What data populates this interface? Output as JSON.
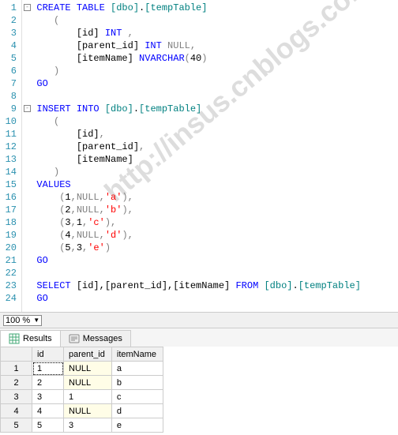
{
  "watermark": "http://insus.cnblogs.com",
  "gutter": [
    "1",
    "2",
    "3",
    "4",
    "5",
    "6",
    "7",
    "8",
    "9",
    "10",
    "11",
    "12",
    "13",
    "14",
    "15",
    "16",
    "17",
    "18",
    "19",
    "20",
    "21",
    "22",
    "23",
    "24"
  ],
  "code": {
    "l1": {
      "pre": "  ",
      "kw1": "CREATE TABLE ",
      "obj": "[dbo]",
      "dot": ".",
      "obj2": "[tempTable]"
    },
    "l2": {
      "pre": "     ",
      "p": "("
    },
    "l3": {
      "pre": "         ",
      "col": "[id] ",
      "type": "INT ",
      "rest": ","
    },
    "l4": {
      "pre": "         ",
      "col": "[parent_id] ",
      "type": "INT ",
      "null": "NULL",
      "rest": ","
    },
    "l5": {
      "pre": "         ",
      "col": "[itemName] ",
      "type": "NVARCHAR",
      "p1": "(",
      "n": "40",
      "p2": ")"
    },
    "l6": {
      "pre": "     ",
      "p": ")"
    },
    "l7": {
      "pre": "  ",
      "kw": "GO"
    },
    "l9": {
      "pre": "  ",
      "kw1": "INSERT INTO ",
      "obj": "[dbo]",
      "dot": ".",
      "obj2": "[tempTable]"
    },
    "l10": {
      "pre": "     ",
      "p": "("
    },
    "l11": {
      "pre": "         ",
      "col": "[id]",
      "c": ","
    },
    "l12": {
      "pre": "         ",
      "col": "[parent_id]",
      "c": ","
    },
    "l13": {
      "pre": "         ",
      "col": "[itemName]"
    },
    "l14": {
      "pre": "     ",
      "p": ")"
    },
    "l15": {
      "pre": "  ",
      "kw": "VALUES"
    },
    "l16": {
      "pre": "      ",
      "p1": "(",
      "n1": "1",
      "c1": ",",
      "null": "NULL",
      "c2": ",",
      "s": "'a'",
      "p2": "),"
    },
    "l17": {
      "pre": "      ",
      "p1": "(",
      "n1": "2",
      "c1": ",",
      "null": "NULL",
      "c2": ",",
      "s": "'b'",
      "p2": "),"
    },
    "l18": {
      "pre": "      ",
      "p1": "(",
      "n1": "3",
      "c1": ",",
      "n2": "1",
      "c2": ",",
      "s": "'c'",
      "p2": "),"
    },
    "l19": {
      "pre": "      ",
      "p1": "(",
      "n1": "4",
      "c1": ",",
      "null": "NULL",
      "c2": ",",
      "s": "'d'",
      "p2": "),"
    },
    "l20": {
      "pre": "      ",
      "p1": "(",
      "n1": "5",
      "c1": ",",
      "n2": "3",
      "c2": ",",
      "s": "'e'",
      "p2": ")"
    },
    "l21": {
      "pre": "  ",
      "kw": "GO"
    },
    "l23": {
      "pre": "  ",
      "kw1": "SELECT ",
      "cols": "[id],[parent_id],[itemName] ",
      "kw2": "FROM ",
      "obj": "[dbo]",
      "dot": ".",
      "obj2": "[tempTable]"
    },
    "l24": {
      "pre": "  ",
      "kw": "GO"
    }
  },
  "zoom": "100 %",
  "tabs": {
    "results": "Results",
    "messages": "Messages"
  },
  "grid": {
    "headers": {
      "id": "id",
      "parent_id": "parent_id",
      "itemName": "itemName"
    },
    "rows": [
      {
        "n": "1",
        "id": "1",
        "parent_id": "NULL",
        "itemName": "a",
        "pnull": true
      },
      {
        "n": "2",
        "id": "2",
        "parent_id": "NULL",
        "itemName": "b",
        "pnull": true
      },
      {
        "n": "3",
        "id": "3",
        "parent_id": "1",
        "itemName": "c",
        "pnull": false
      },
      {
        "n": "4",
        "id": "4",
        "parent_id": "NULL",
        "itemName": "d",
        "pnull": true
      },
      {
        "n": "5",
        "id": "5",
        "parent_id": "3",
        "itemName": "e",
        "pnull": false
      }
    ]
  }
}
